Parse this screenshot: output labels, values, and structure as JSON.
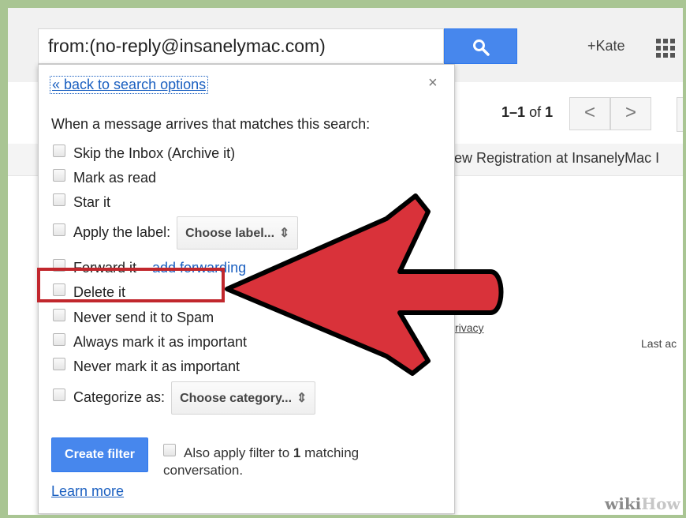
{
  "search": {
    "query": "from:(no-reply@insanelymac.com)"
  },
  "header": {
    "account_label": "+Kate"
  },
  "pager": {
    "range": "1–1",
    "of_label": "of",
    "total": "1",
    "prev": "<",
    "next": ">"
  },
  "mail": {
    "subject_fragment": "ew Registration at InsanelyMac I",
    "privacy_fragment": "rivacy",
    "last_activity_fragment": "Last ac"
  },
  "filter_panel": {
    "back_link": "« back to search options",
    "close": "×",
    "prompt": "When a message arrives that matches this search:",
    "options": {
      "skip_inbox": "Skip the Inbox (Archive it)",
      "mark_read": "Mark as read",
      "star": "Star it",
      "apply_label": "Apply the label:",
      "label_select": "Choose label...",
      "forward": "Forward it",
      "forward_link": "add forwarding",
      "delete": "Delete it",
      "never_spam": "Never send it to Spam",
      "always_important": "Always mark it as important",
      "never_important": "Never mark it as important",
      "categorize": "Categorize as:",
      "category_select": "Choose category..."
    },
    "create_button": "Create filter",
    "also_apply_prefix": "Also apply filter to",
    "also_apply_count": "1",
    "also_apply_suffix": "matching conversation.",
    "learn_more": "Learn more"
  },
  "watermark": {
    "wiki": "wiki",
    "how": "How"
  },
  "colors": {
    "accent_blue": "#4787ed",
    "highlight_red": "#c1272d",
    "arrow_red": "#d9323a"
  }
}
